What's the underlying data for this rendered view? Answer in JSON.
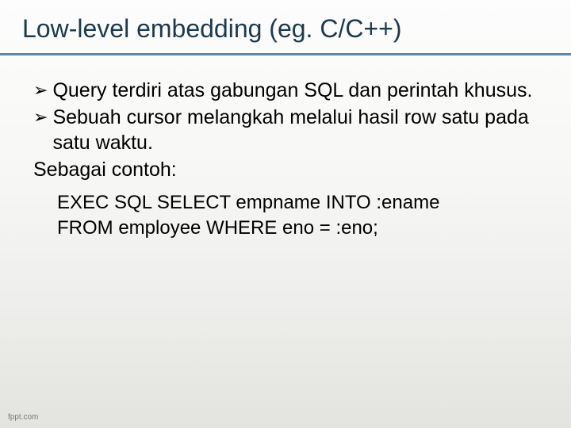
{
  "title": "Low-level embedding (eg. C/C++)",
  "bullets": [
    "Query terdiri atas gabungan SQL dan perintah khusus.",
    "Sebuah cursor melangkah melalui hasil row satu pada satu waktu."
  ],
  "plain_line": "Sebagai contoh:",
  "code": {
    "line1": "EXEC SQL SELECT empname INTO :ename",
    "line2": "FROM employee WHERE eno = :eno;"
  },
  "footer": "fppt.com",
  "arrow_glyph": "➢"
}
